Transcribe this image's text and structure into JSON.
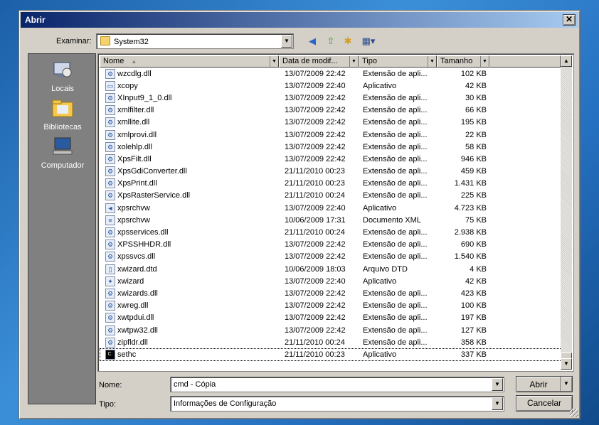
{
  "window": {
    "title": "Abrir",
    "close_label": "✕"
  },
  "lookin": {
    "label": "Examinar:",
    "value": "System32"
  },
  "toolbar": {
    "back": "◀",
    "up": "⇧",
    "newfolder": "✱",
    "views": "▦▾"
  },
  "places": [
    {
      "label": "Locais",
      "icon": "recent-places-icon"
    },
    {
      "label": "Bibliotecas",
      "icon": "libraries-icon"
    },
    {
      "label": "Computador",
      "icon": "computer-icon"
    }
  ],
  "columns": {
    "name": "Nome",
    "date": "Data de modif...",
    "type": "Tipo",
    "size": "Tamanho"
  },
  "files": [
    {
      "name": "wzcdlg.dll",
      "date": "13/07/2009 22:42",
      "type": "Extensão de apli...",
      "size": "102 KB",
      "icon": "dll-icon"
    },
    {
      "name": "xcopy",
      "date": "13/07/2009 22:40",
      "type": "Aplicativo",
      "size": "42 KB",
      "icon": "exe-icon"
    },
    {
      "name": "XInput9_1_0.dll",
      "date": "13/07/2009 22:42",
      "type": "Extensão de apli...",
      "size": "30 KB",
      "icon": "dll-icon"
    },
    {
      "name": "xmlfilter.dll",
      "date": "13/07/2009 22:42",
      "type": "Extensão de apli...",
      "size": "66 KB",
      "icon": "dll-icon"
    },
    {
      "name": "xmllite.dll",
      "date": "13/07/2009 22:42",
      "type": "Extensão de apli...",
      "size": "195 KB",
      "icon": "dll-icon"
    },
    {
      "name": "xmlprovi.dll",
      "date": "13/07/2009 22:42",
      "type": "Extensão de apli...",
      "size": "22 KB",
      "icon": "dll-icon"
    },
    {
      "name": "xolehlp.dll",
      "date": "13/07/2009 22:42",
      "type": "Extensão de apli...",
      "size": "58 KB",
      "icon": "dll-icon"
    },
    {
      "name": "XpsFilt.dll",
      "date": "13/07/2009 22:42",
      "type": "Extensão de apli...",
      "size": "946 KB",
      "icon": "dll-icon"
    },
    {
      "name": "XpsGdiConverter.dll",
      "date": "21/11/2010 00:23",
      "type": "Extensão de apli...",
      "size": "459 KB",
      "icon": "dll-icon"
    },
    {
      "name": "XpsPrint.dll",
      "date": "21/11/2010 00:23",
      "type": "Extensão de apli...",
      "size": "1.431 KB",
      "icon": "dll-icon"
    },
    {
      "name": "XpsRasterService.dll",
      "date": "21/11/2010 00:24",
      "type": "Extensão de apli...",
      "size": "225 KB",
      "icon": "dll-icon"
    },
    {
      "name": "xpsrchvw",
      "date": "13/07/2009 22:40",
      "type": "Aplicativo",
      "size": "4.723 KB",
      "icon": "xps-viewer-icon"
    },
    {
      "name": "xpsrchvw",
      "date": "10/06/2009 17:31",
      "type": "Documento XML",
      "size": "75 KB",
      "icon": "xml-icon"
    },
    {
      "name": "xpsservices.dll",
      "date": "21/11/2010 00:24",
      "type": "Extensão de apli...",
      "size": "2.938 KB",
      "icon": "dll-icon"
    },
    {
      "name": "XPSSHHDR.dll",
      "date": "13/07/2009 22:42",
      "type": "Extensão de apli...",
      "size": "690 KB",
      "icon": "dll-icon"
    },
    {
      "name": "xpssvcs.dll",
      "date": "13/07/2009 22:42",
      "type": "Extensão de apli...",
      "size": "1.540 KB",
      "icon": "dll-icon"
    },
    {
      "name": "xwizard.dtd",
      "date": "10/06/2009 18:03",
      "type": "Arquivo DTD",
      "size": "4 KB",
      "icon": "dtd-icon"
    },
    {
      "name": "xwizard",
      "date": "13/07/2009 22:40",
      "type": "Aplicativo",
      "size": "42 KB",
      "icon": "wizard-icon"
    },
    {
      "name": "xwizards.dll",
      "date": "13/07/2009 22:42",
      "type": "Extensão de apli...",
      "size": "423 KB",
      "icon": "dll-icon"
    },
    {
      "name": "xwreg.dll",
      "date": "13/07/2009 22:42",
      "type": "Extensão de apli...",
      "size": "100 KB",
      "icon": "dll-icon"
    },
    {
      "name": "xwtpdui.dll",
      "date": "13/07/2009 22:42",
      "type": "Extensão de apli...",
      "size": "197 KB",
      "icon": "dll-icon"
    },
    {
      "name": "xwtpw32.dll",
      "date": "13/07/2009 22:42",
      "type": "Extensão de apli...",
      "size": "127 KB",
      "icon": "dll-icon"
    },
    {
      "name": "zipfldr.dll",
      "date": "21/11/2010 00:24",
      "type": "Extensão de apli...",
      "size": "358 KB",
      "icon": "dll-icon"
    },
    {
      "name": "sethc",
      "date": "21/11/2010 00:23",
      "type": "Aplicativo",
      "size": "337 KB",
      "icon": "cmd-icon",
      "selected": true
    }
  ],
  "filename": {
    "label": "Nome:",
    "value": "cmd - Cópia"
  },
  "filetype": {
    "label": "Tipo:",
    "value": "Informações de Configuração"
  },
  "buttons": {
    "open": "Abrir",
    "cancel": "Cancelar"
  }
}
